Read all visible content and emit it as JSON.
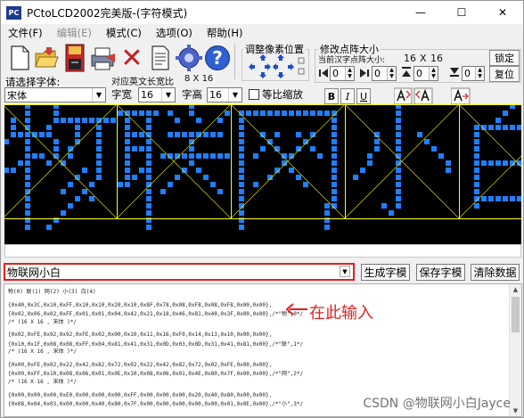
{
  "window": {
    "icon_text": "PC",
    "title": "PCtoLCD2002完美版-(字符模式)",
    "minimize": "—",
    "maximize": "☐",
    "close": "✕"
  },
  "menu": [
    {
      "label": "文件(F)",
      "enabled": true
    },
    {
      "label": "编辑(E)",
      "enabled": false
    },
    {
      "label": "模式(C)",
      "enabled": true
    },
    {
      "label": "选项(O)",
      "enabled": true
    },
    {
      "label": "帮助(H)",
      "enabled": true
    }
  ],
  "toolbar": {
    "icons": [
      "new-file-icon",
      "open-folder-icon",
      "save-icon",
      "print-icon",
      "delete-icon",
      "document-icon",
      "settings-gear-icon",
      "help-icon"
    ],
    "help_glyph": "?",
    "delete_glyph": "✕"
  },
  "pixel_adjust": {
    "title": "调整像素位置"
  },
  "dot_matrix": {
    "title": "修改点阵大小",
    "current_label": "当前汉字点阵大小:",
    "width": "16",
    "x": "X",
    "height": "16",
    "spin_values": [
      "0",
      "0",
      "0",
      "0"
    ],
    "lock_label": "锁定",
    "reset_label": "复位"
  },
  "font": {
    "select_label": "请选择字体:",
    "ascii_width_label": "对应英文长宽比",
    "ascii_ratio": "8 X 16",
    "font_name": "宋体",
    "width_label": "字宽",
    "width_value": "16",
    "height_label": "字高",
    "height_value": "16",
    "proportional_label": "等比缩放",
    "bold": "B",
    "italic": "I",
    "underline": "U"
  },
  "preview": {
    "characters": [
      "物",
      "联",
      "网",
      "小",
      "白"
    ],
    "grid_color": "#ffff00",
    "dot_color": "#1e7fff",
    "background": "#000000"
  },
  "input": {
    "value": "物联网小白"
  },
  "buttons": {
    "generate": "生成字模",
    "save": "保存字模",
    "clear": "清除数据"
  },
  "output": {
    "lines": [
      "物(0) 联(1) 网(2) 小(3) 白(4)",
      "",
      "{0x40,0x3C,0x10,0xFF,0x10,0x10,0x20,0x10,0x8F,0x78,0x08,0xF8,0x08,0xF8,0x00,0x00},",
      "{0x02,0x06,0x02,0xFF,0x01,0x01,0x04,0x42,0x21,0x18,0x46,0x81,0x40,0x3F,0x00,0x00},/*\"物\",0*/",
      "/* (16 X 16 , 宋体 )*/",
      "",
      "{0x02,0xFE,0x92,0x92,0xFE,0x02,0x00,0x10,0x11,0x16,0xF0,0x14,0x13,0x10,0x00,0x00},",
      "{0x10,0x1F,0x08,0x08,0xFF,0x04,0x81,0x41,0x31,0x0D,0x03,0x0D,0x31,0x41,0x81,0x00},/*\"联\",1*/",
      "/* (16 X 16 , 宋体 )*/",
      "",
      "{0x00,0xFE,0x02,0x22,0x42,0x82,0x72,0x02,0x22,0x42,0x82,0x72,0x02,0xFE,0x00,0x00},",
      "{0x00,0xFF,0x10,0x08,0x06,0x01,0x0E,0x10,0x08,0x06,0x01,0x4E,0x80,0x7F,0x00,0x00},/*\"网\",2*/",
      "/* (16 X 16 , 宋体 )*/",
      "",
      "{0x00,0x00,0x00,0xE0,0x00,0x00,0x00,0xFF,0x00,0x00,0x00,0x20,0x40,0x80,0x00,0x00},",
      "{0x08,0x04,0x03,0x00,0x00,0x40,0x80,0x7F,0x00,0x00,0x00,0x00,0x00,0x01,0x0E,0x00},/*\"小\",3*/"
    ]
  },
  "annotation": {
    "text": "在此输入",
    "color": "#e02020"
  },
  "watermark": "CSDN @物联网小白Jayce"
}
